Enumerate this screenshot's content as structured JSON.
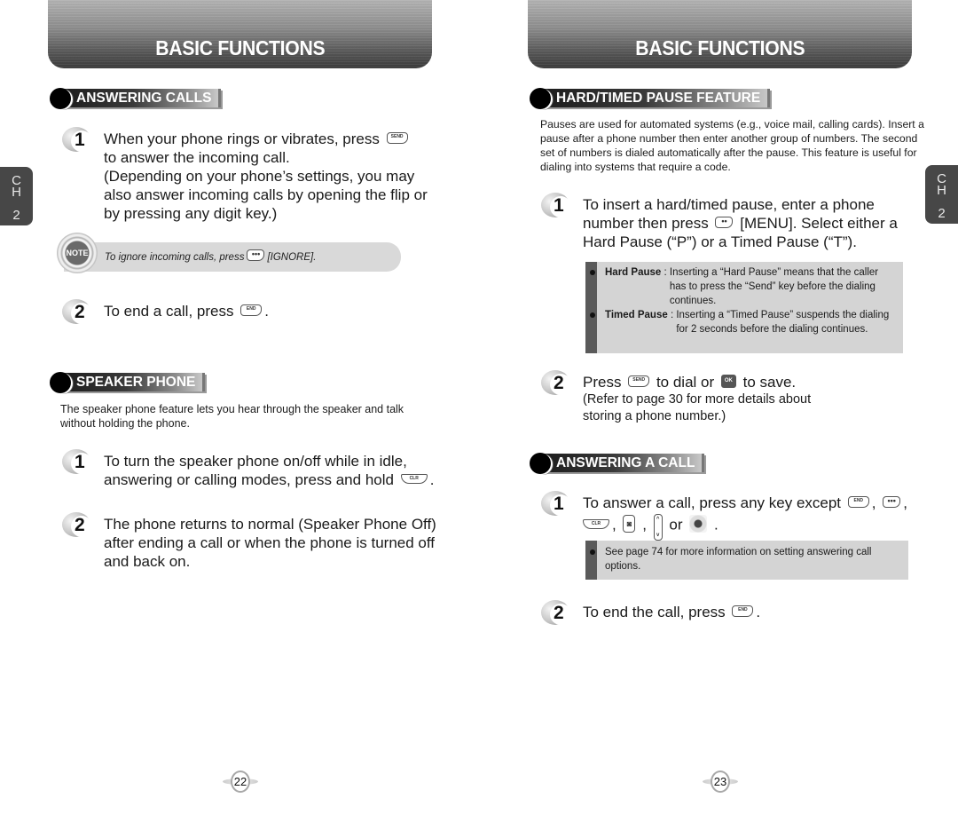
{
  "left_page": {
    "banner_title": "BASIC FUNCTIONS",
    "chapter_tab": {
      "letters": [
        "C",
        "H"
      ],
      "number": "2"
    },
    "sections": {
      "answering_calls": {
        "title": "ANSWERING CALLS",
        "step1": {
          "number": "1",
          "text_a": "When your phone rings or vibrates, press",
          "key": "SEND",
          "text_b": "to answer the incoming call.",
          "text_c": "(Depending on your phone’s settings, you may also answer incoming calls by opening the flip or by pressing any digit key.)"
        },
        "note": {
          "badge": "NOTE",
          "text_a": "To ignore incoming calls, press",
          "key": "•••",
          "text_b": "[IGNORE]."
        },
        "step2": {
          "number": "2",
          "text_a": "To end a call, press",
          "key": "END",
          "text_b": "."
        }
      },
      "speaker_phone": {
        "title": "SPEAKER PHONE",
        "intro": "The speaker phone feature lets you hear through the speaker and talk without holding the phone.",
        "step1": {
          "number": "1",
          "text_a": "To turn the speaker phone on/off while in idle, answering or calling modes, press and hold",
          "key": "CLR",
          "text_b": "."
        },
        "step2": {
          "number": "2",
          "text": "The phone returns to normal (Speaker Phone Off) after ending a call or when the phone is turned off and back on."
        }
      }
    },
    "page_number": "22"
  },
  "right_page": {
    "banner_title": "BASIC FUNCTIONS",
    "chapter_tab": {
      "letters": [
        "C",
        "H"
      ],
      "number": "2"
    },
    "sections": {
      "hard_timed_pause": {
        "title": "HARD/TIMED PAUSE FEATURE",
        "intro": "Pauses are used for automated systems (e.g., voice mail, calling cards). Insert a pause after a phone number then enter another group of numbers. The second set of numbers is dialed automatically after the pause. This feature is useful for dialing into systems that require a code.",
        "step1": {
          "number": "1",
          "text_a": "To insert a hard/timed pause, enter a phone number then press",
          "key": "••",
          "text_b": "[MENU]. Select either a Hard Pause (“P”) or a Timed Pause (“T”)."
        },
        "info": [
          {
            "term": "Hard Pause",
            "sep": " : ",
            "definition": "Inserting a “Hard Pause” means that the caller has to press the “Send” key before the dialing continues."
          },
          {
            "term": "Timed Pause",
            "sep": " : ",
            "definition": "Inserting a “Timed Pause” suspends the dialing for 2 seconds before the dialing continues."
          }
        ],
        "step2": {
          "number": "2",
          "text_a": "Press",
          "key1": "SEND",
          "text_b": "to dial or",
          "key2": "OK",
          "text_c": "to save.",
          "sub": "(Refer to page 30 for more details about storing a phone number.)"
        }
      },
      "answering_a_call": {
        "title": "ANSWERING A CALL",
        "step1": {
          "number": "1",
          "text_a": "To answer a call, press any key except",
          "key_end": "END",
          "sep1": ",",
          "key_menu": "•••",
          "sep2": ",",
          "key_clr": "CLR",
          "sep3": ",",
          "key_cam": "◙",
          "sep4": ",",
          "key_vol_up": "^",
          "key_vol_down": "v",
          "text_or": "or",
          "text_end": "."
        },
        "info": "See page 74 for more information on setting answering call options.",
        "step2": {
          "number": "2",
          "text_a": "To end the call, press",
          "key": "END",
          "text_b": "."
        }
      }
    },
    "page_number": "23"
  },
  "colors": {
    "banner_dark": "#3b3b3b",
    "banner_light": "#b4b4b4",
    "chapter_tab": "#474747",
    "note_bg": "#d9d9d9",
    "info_bg": "#d4d4d4",
    "info_rail": "#5a5a5a"
  }
}
